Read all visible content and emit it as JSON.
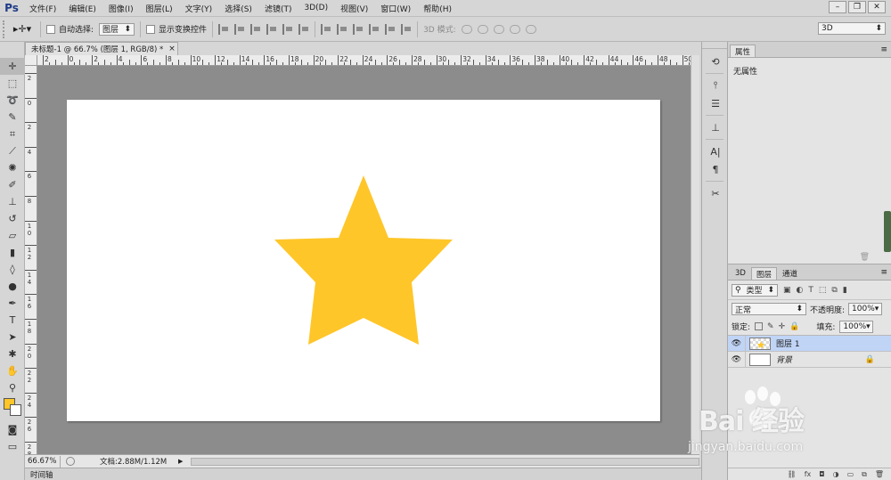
{
  "app": {
    "logo": "Ps",
    "menu": [
      "文件(F)",
      "编辑(E)",
      "图像(I)",
      "图层(L)",
      "文字(Y)",
      "选择(S)",
      "滤镜(T)",
      "3D(D)",
      "视图(V)",
      "窗口(W)",
      "帮助(H)"
    ]
  },
  "options": {
    "auto_select_label": "自动选择:",
    "auto_select_value": "图层",
    "show_transform_label": "显示变换控件",
    "mode3d_label": "3D 模式:",
    "workspace_value": "3D"
  },
  "document": {
    "tab_title": "未标题-1 @ 66.7% (图层 1, RGB/8) *",
    "tab_close": "×",
    "ruler_top": [
      "2",
      "0",
      "2",
      "4",
      "6",
      "8",
      "10",
      "12",
      "14",
      "16",
      "18",
      "20",
      "22",
      "24",
      "26",
      "28",
      "30",
      "32",
      "34",
      "36",
      "38",
      "40",
      "42",
      "44",
      "46",
      "48",
      "50"
    ],
    "ruler_left": [
      "2",
      "0",
      "2",
      "4",
      "6",
      "8",
      "10",
      "12",
      "14",
      "16",
      "18",
      "20",
      "22",
      "24",
      "26",
      "28"
    ],
    "star_color": "#ffc629",
    "canvas_bg": "#8c8c8c"
  },
  "status": {
    "zoom": "66.67%",
    "doc_info": "文档:2.88M/1.12M"
  },
  "timeline_label": "时间轴",
  "properties": {
    "tab": "属性",
    "empty_text": "无属性"
  },
  "layers_panel": {
    "tabs": [
      "3D",
      "图层",
      "通道"
    ],
    "filter_label": "类型",
    "blend_mode": "正常",
    "opacity_label": "不透明度:",
    "opacity_value": "100%",
    "lock_label": "锁定:",
    "fill_label": "填充:",
    "fill_value": "100%",
    "layers": [
      {
        "name": "图层 1",
        "selected": true
      },
      {
        "name": "背景",
        "selected": false
      }
    ],
    "footer_icons": [
      "link-icon",
      "fx-icon",
      "mask-icon",
      "adjustment-icon",
      "group-icon",
      "new-layer-icon",
      "trash-icon"
    ]
  },
  "watermark": {
    "brand": "Bai 经验",
    "url": "jingyan.baidu.com"
  }
}
